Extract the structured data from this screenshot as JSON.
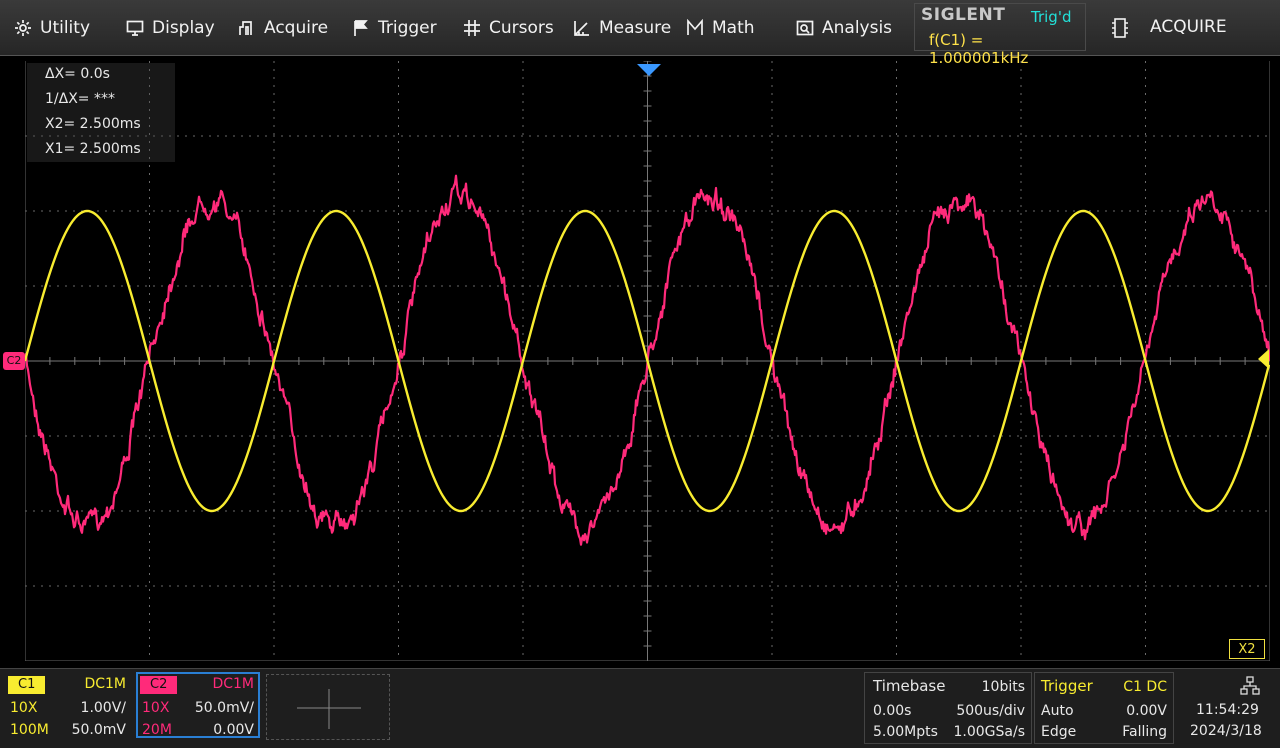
{
  "menu": {
    "items": [
      {
        "label": "Utility",
        "icon": "gear-icon"
      },
      {
        "label": "Display",
        "icon": "monitor-icon"
      },
      {
        "label": "Acquire",
        "icon": "acquire-icon"
      },
      {
        "label": "Trigger",
        "icon": "flag-icon"
      },
      {
        "label": "Cursors",
        "icon": "crosshair-icon"
      },
      {
        "label": "Measure",
        "icon": "measure-icon"
      },
      {
        "label": "Math",
        "icon": "math-icon"
      },
      {
        "label": "Analysis",
        "icon": "analysis-icon"
      }
    ],
    "brand": "SIGLENT",
    "trig_status": "Trig'd",
    "frequency": "f(C1) = 1.000001kHz",
    "acquire_label": "ACQUIRE"
  },
  "cursors": {
    "delta_x": "ΔX= 0.0s",
    "inv_delta_x": "1/ΔX= ***",
    "x2": "X2= 2.500ms",
    "x1": "X1= 2.500ms",
    "x2_tag": "X2"
  },
  "markers": {
    "c2_label": "C2"
  },
  "channels": {
    "c1": {
      "name": "C1",
      "coupling": "DC1M",
      "probe": "10X",
      "scale": "1.00V/",
      "bandwidth": "100M",
      "offset": "50.0mV",
      "color": "#f8ec30"
    },
    "c2": {
      "name": "C2",
      "coupling": "DC1M",
      "probe": "10X",
      "scale": "50.0mV/",
      "bandwidth": "20M",
      "offset": "0.00V",
      "color": "#ff2a7a"
    }
  },
  "timebase": {
    "label": "Timebase",
    "bits": "10bits",
    "delay": "0.00s",
    "scale": "500us/div",
    "memory": "5.00Mpts",
    "sample_rate": "1.00GSa/s"
  },
  "trigger": {
    "label": "Trigger",
    "coupling": "C1 DC",
    "mode": "Auto",
    "level": "0.00V",
    "type": "Edge",
    "slope": "Falling"
  },
  "clock": {
    "time": "11:54:29",
    "date": "2024/3/18"
  },
  "waveforms": {
    "c1_color": "#f8ec30",
    "c2_color": "#ff2a7a",
    "c1_cycles_on_screen": 5,
    "c1_amplitude_div": 2,
    "c2_amplitude_div": 2.2
  }
}
